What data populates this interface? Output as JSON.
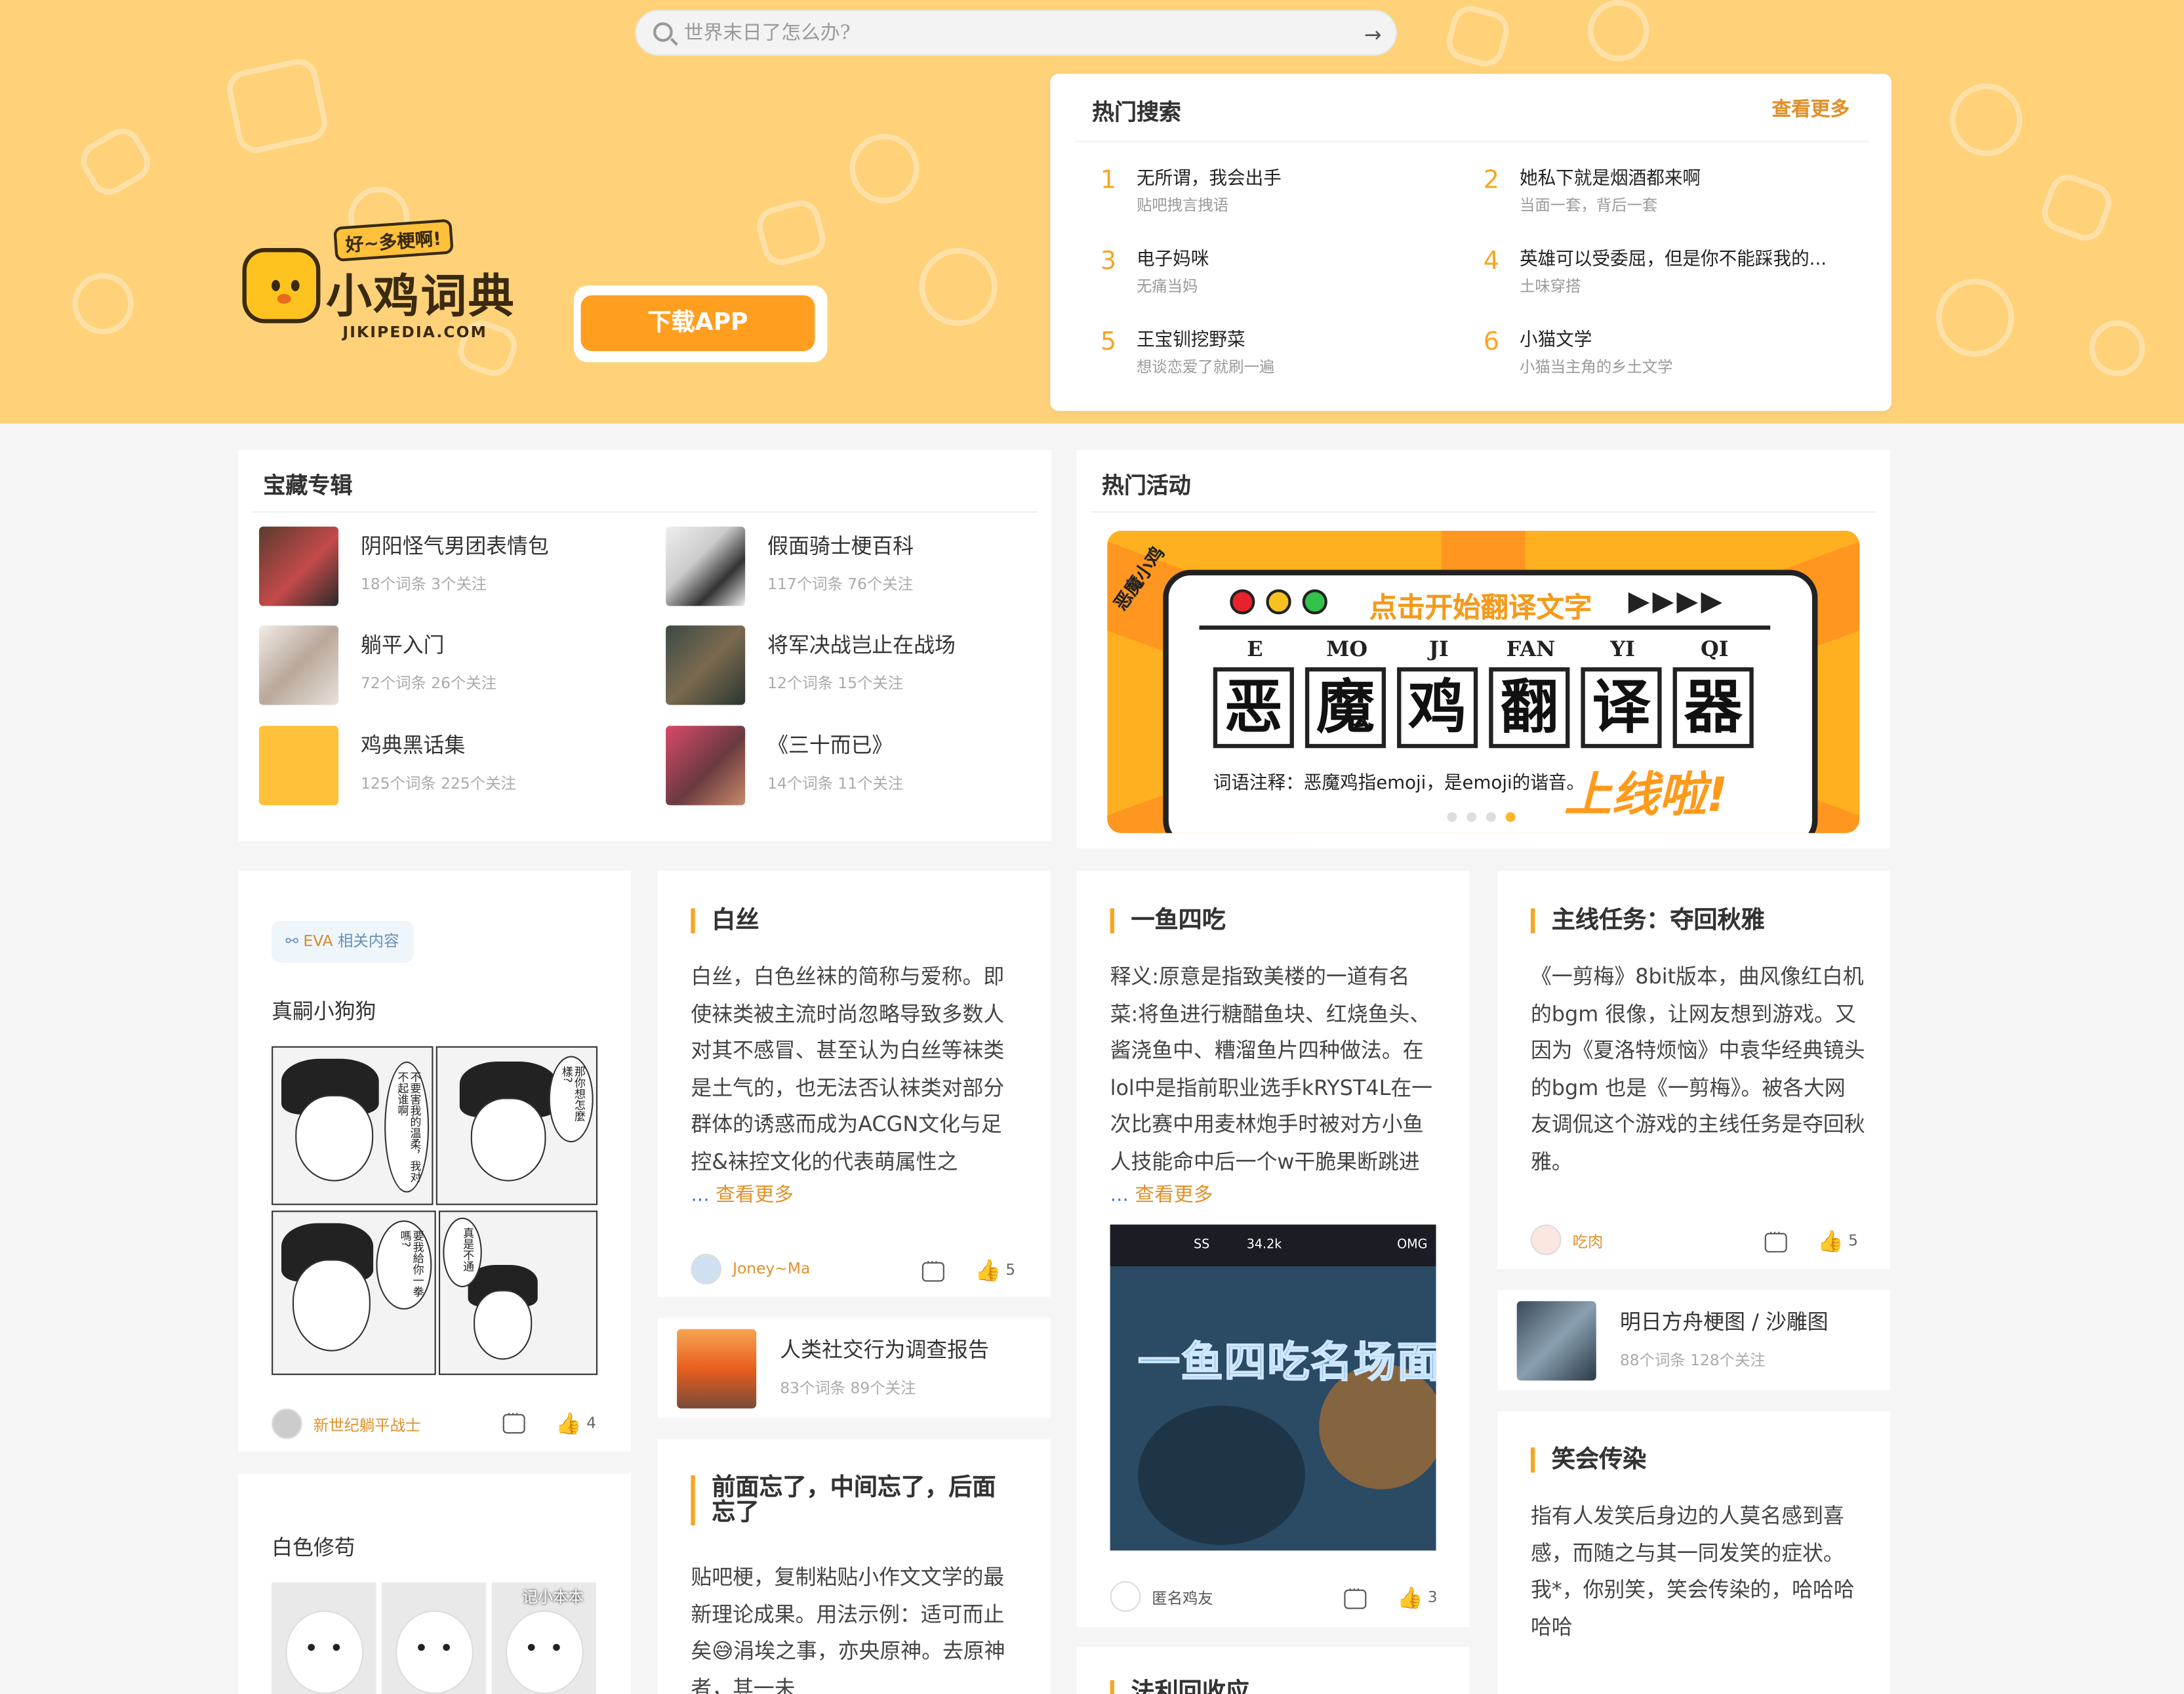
{
  "search": {
    "placeholder": "世界末日了怎么办?"
  },
  "brand": {
    "tagline": "好~多梗啊!",
    "name": "小鸡词典",
    "domain": "JIKIPEDIA.COM",
    "download_label": "下载APP"
  },
  "hot_search": {
    "title": "热门搜索",
    "more_label": "查看更多",
    "items": [
      {
        "rank": "1",
        "title": "无所谓，我会出手",
        "sub": "贴吧拽言拽语"
      },
      {
        "rank": "2",
        "title": "她私下就是烟酒都来啊",
        "sub": "当面一套，背后一套"
      },
      {
        "rank": "3",
        "title": "电子妈咪",
        "sub": "无痛当妈"
      },
      {
        "rank": "4",
        "title": "英雄可以受委屈，但是你不能踩我的...",
        "sub": "土味穿搭"
      },
      {
        "rank": "5",
        "title": "王宝钏挖野菜",
        "sub": "想谈恋爱了就刷一遍"
      },
      {
        "rank": "6",
        "title": "小猫文学",
        "sub": "小猫当主角的乡土文学"
      }
    ]
  },
  "treasure": {
    "title": "宝藏专辑",
    "albums": [
      {
        "name": "阴阳怪气男团表情包",
        "meta": "18个词条  3个关注"
      },
      {
        "name": "假面骑士梗百科",
        "meta": "117个词条  76个关注"
      },
      {
        "name": "躺平入门",
        "meta": "72个词条  26个关注"
      },
      {
        "name": "将军决战岂止在战场",
        "meta": "12个词条  15个关注"
      },
      {
        "name": "鸡典黑话集",
        "meta": "125个词条  225个关注"
      },
      {
        "name": "《三十而已》",
        "meta": "14个词条  11个关注"
      }
    ]
  },
  "activity": {
    "title": "热门活动",
    "banner": {
      "side": "恶魔小鸡",
      "headline": "点击开始翻译文字",
      "arrows": "▶▶▶▶",
      "pinyin": [
        "E",
        "MO",
        "JI",
        "FAN",
        "YI",
        "QI"
      ],
      "chars": [
        "恶",
        "魔",
        "鸡",
        "翻",
        "译",
        "器"
      ],
      "note": "词语注释：恶魔鸡指emoji，是emoji的谐音。",
      "cta": "上线啦!"
    }
  },
  "feed": {
    "card1": {
      "tag_label": "EVA",
      "tag_suffix": "相关内容",
      "name": "真嗣小狗狗",
      "author": "新世纪躺平战士",
      "likes": "4",
      "bubbles": [
        "不要害我的温柔，我对不起谁啊",
        "那你想怎麼樣?",
        "要我給你一拳嗎?",
        "真是不通"
      ]
    },
    "card2": {
      "name": "白色修苟",
      "dog_label": "记小本本"
    },
    "card3": {
      "title": "白丝",
      "body": "白丝，白色丝袜的简称与爱称。即使袜类被主流时尚忽略导致多数人对其不感冒、甚至认为白丝等袜类是土气的，也无法否认袜类对部分群体的诱惑而成为ACGN文化与足控&袜控文化的代表萌属性之",
      "more": "查看更多",
      "author": "Joney~Ma",
      "likes": "5"
    },
    "card4": {
      "name": "人类社交行为调查报告",
      "meta": "83个词条  89个关注"
    },
    "card5": {
      "title": "前面忘了，中间忘了，后面忘了",
      "body": "贴吧梗，复制粘贴小作文文学的最新理论成果。用法示例：适可而止矣😅涓埃之事，亦央原神。去原神者，其一未"
    },
    "card6": {
      "title": "一鱼四吃",
      "body": "释义:原意是指致美楼的一道有名菜:将鱼进行糖醋鱼块、红烧鱼头、酱浇鱼中、糟溜鱼片四种做法。在lol中是指前职业选手kRYST4L在一次比赛中用麦林炮手时被对方小鱼人技能命中后一个w干脆果断跳进",
      "more": "查看更多",
      "caption": "一鱼四吃名场面",
      "hud_left": "SS",
      "hud_mid": "34.2k",
      "hud_right": "OMG",
      "author": "匿名鸡友",
      "likes": "3"
    },
    "card7": {
      "title": "法利回收应"
    },
    "card8": {
      "title": "主线任务：夺回秋雅",
      "body": "《一剪梅》8bit版本，曲风像红白机的bgm 很像，让网友想到游戏。又因为《夏洛特烦恼》中袁华经典镜头的bgm 也是《一剪梅》。被各大网友调侃这个游戏的主线任务是夺回秋雅。",
      "author": "吃肉",
      "likes": "5"
    },
    "card9": {
      "name": "明日方舟梗图 / 沙雕图",
      "meta": "88个词条  128个关注"
    },
    "card10": {
      "title": "笑会传染",
      "body": "指有人发笑后身边的人莫名感到喜感，而随之与其一同发笑的症状。我*，你别笑，笑会传染的，哈哈哈哈哈"
    }
  },
  "colors": {
    "hero": "#ffd27a",
    "accent": "#f5a623",
    "button": "#ff9e1f"
  }
}
